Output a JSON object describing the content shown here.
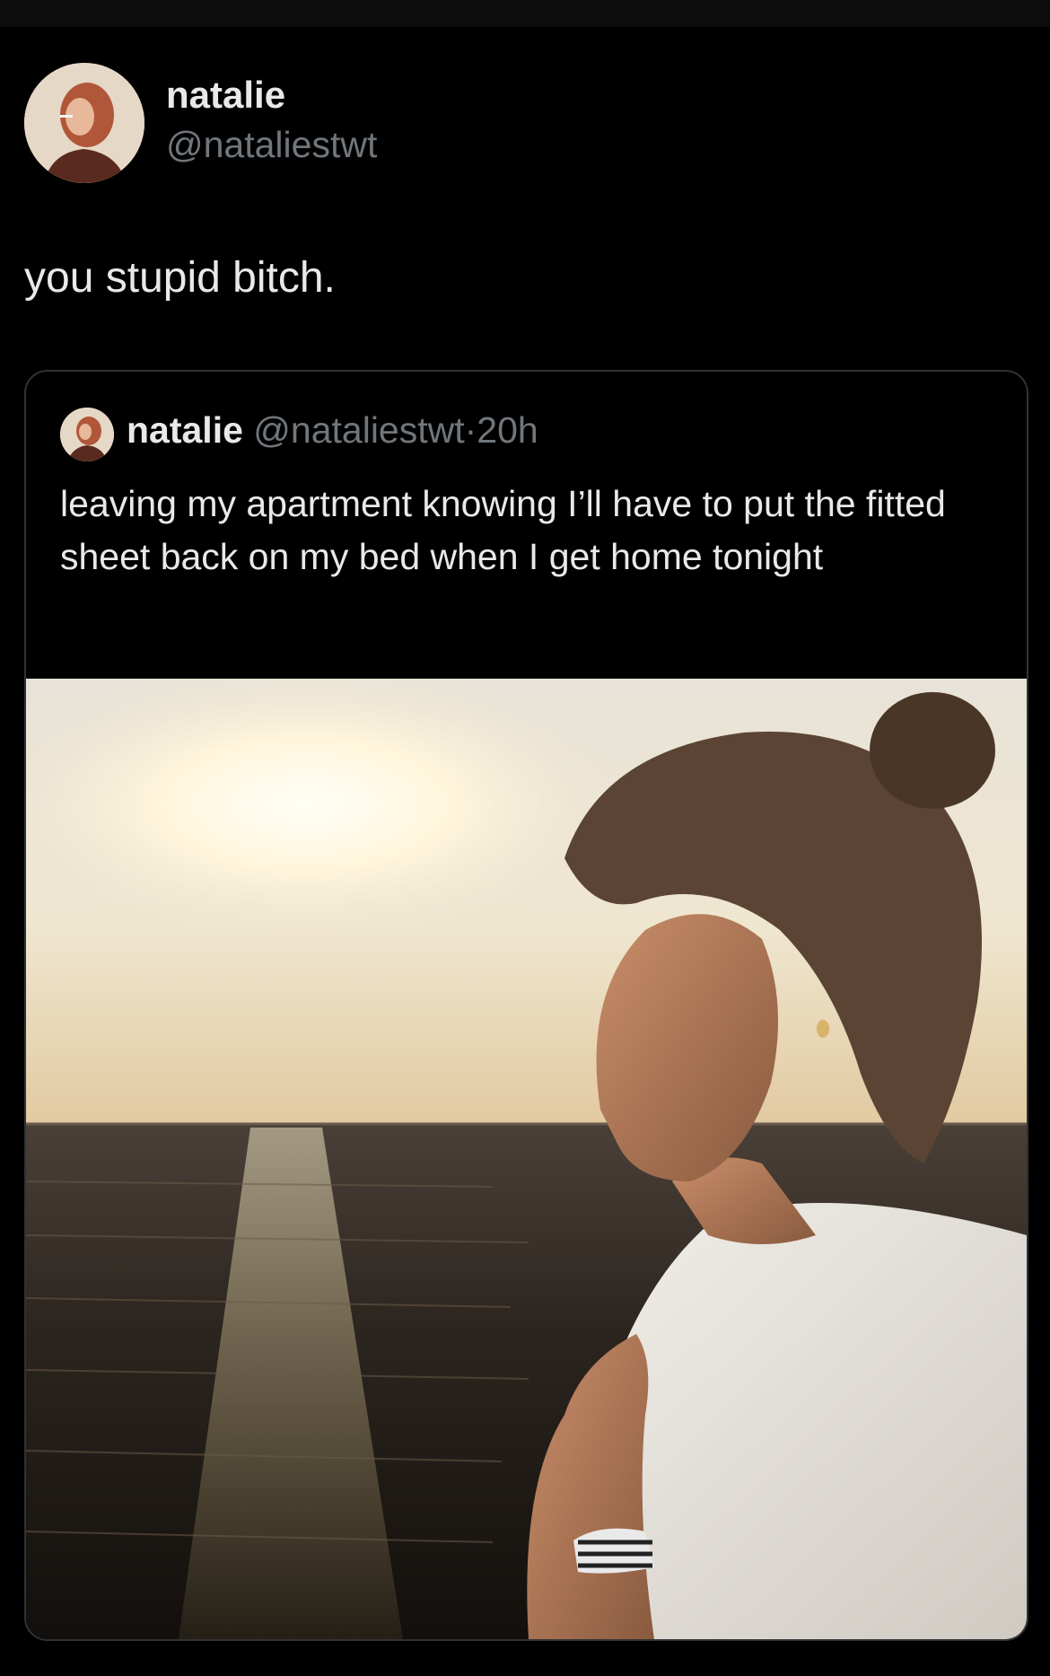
{
  "tweet": {
    "author_name": "natalie",
    "author_handle": "@nataliestwt",
    "text": "you stupid bitch."
  },
  "quoted_tweet": {
    "author_name": "natalie",
    "author_handle": "@nataliestwt",
    "separator": "·",
    "time": "20h",
    "text": "leaving my apartment knowing I’ll have to put the fitted sheet back on my bed when I get home tonight"
  },
  "colors": {
    "background": "#000000",
    "primary_text": "#e7e9ea",
    "secondary_text": "#71767b",
    "card_border": "#2f3336"
  }
}
